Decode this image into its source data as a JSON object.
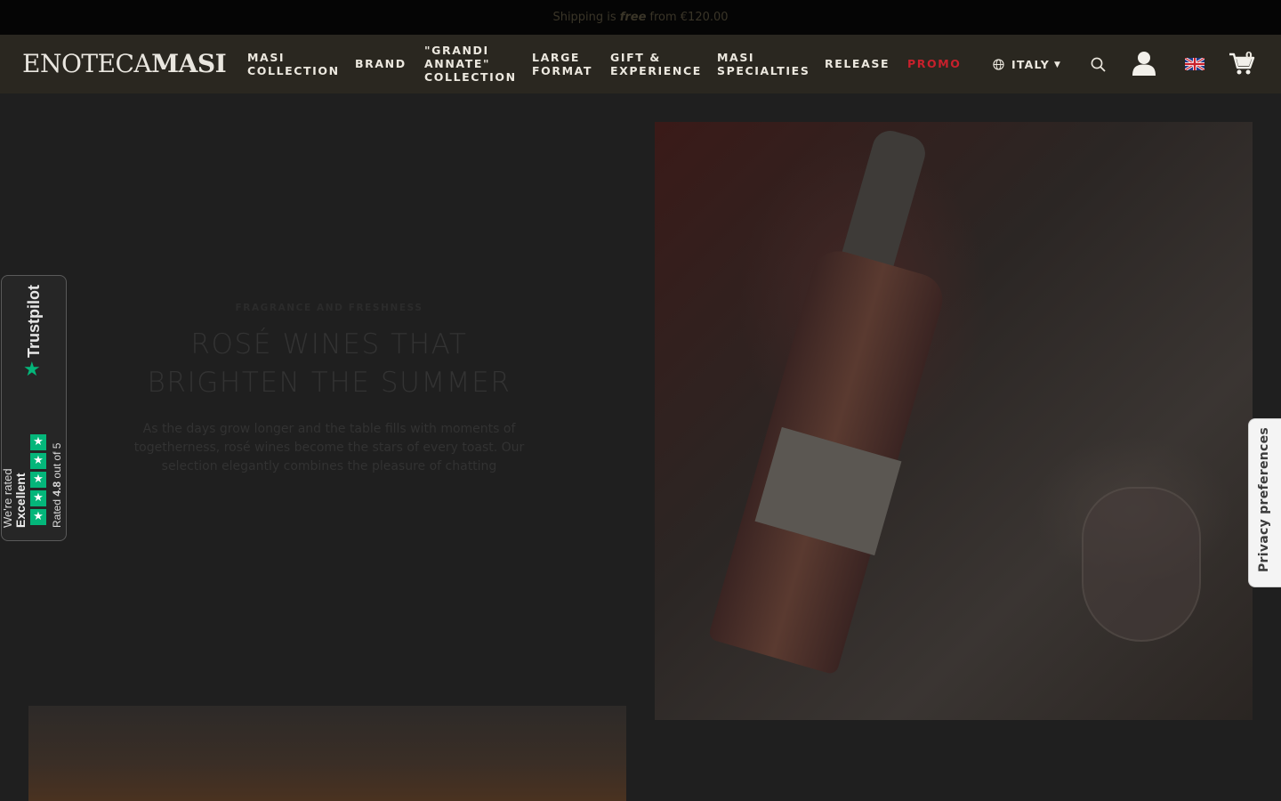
{
  "announcement": {
    "prefix": "Shipping is",
    "emphasis": "free",
    "suffix": "from €120.00"
  },
  "header": {
    "logo_thin": "ENOTECA",
    "logo_bold": "MASI",
    "nav": [
      {
        "label": "MASI\nCOLLECTION"
      },
      {
        "label": "BRAND"
      },
      {
        "label": "\"GRANDI\nANNATE\"\nCOLLECTION"
      },
      {
        "label": "LARGE\nFORMAT"
      },
      {
        "label": "GIFT &\nEXPERIENCE"
      },
      {
        "label": "MASI\nSPECIALTIES"
      },
      {
        "label": "RELEASE"
      },
      {
        "label": "PROMO"
      }
    ],
    "country": "ITALY",
    "cart_count": "0",
    "icons": [
      "globe-icon",
      "search-icon",
      "user-icon",
      "uk-flag-icon",
      "cart-icon"
    ]
  },
  "hero": {
    "kicker": "FRAGRANCE AND FRESHNESS",
    "title": "ROSÉ WINES THAT BRIGHTEN THE SUMMER",
    "description": "As the days grow longer and the table fills with moments of togetherness, rosé wines become the stars of every toast. Our selection elegantly combines the pleasure of chatting"
  },
  "trustpilot": {
    "brand": "Trustpilot",
    "line1": "We're rated",
    "line2": "Excellent",
    "rating_prefix": "Rated",
    "rating_value": "4.8",
    "rating_suffix": "out of 5",
    "stars": 5,
    "accent": "#04b67a"
  },
  "privacy": {
    "label": "Privacy preferences"
  },
  "colors": {
    "header_bg": "#2a2720",
    "promo": "#c8202c",
    "topbar_bg": "#050505"
  }
}
